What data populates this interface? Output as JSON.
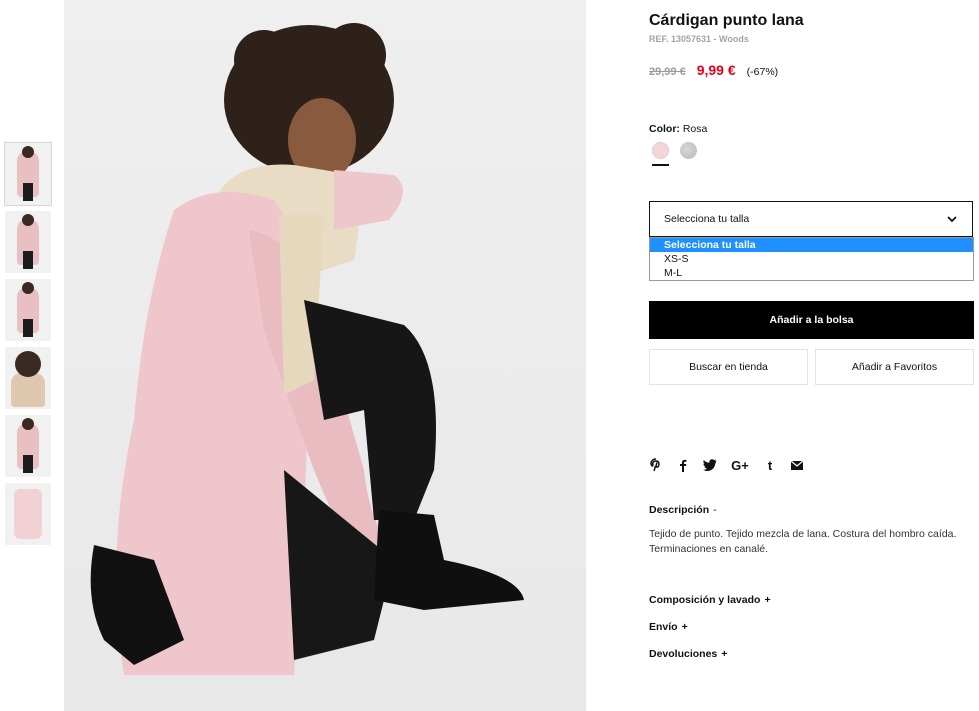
{
  "product": {
    "title": "Cárdigan punto lana",
    "ref": "REF. 13057631 - Woods",
    "old_price": "29,99 €",
    "new_price": "9,99 €",
    "discount": "(-67%)",
    "color_label": "Color:",
    "color_value": "Rosa"
  },
  "colors": {
    "accent_red": "#e3001b",
    "swatch_rosa": "#f3d6d8",
    "swatch_gris": "#c4c4c4",
    "dropdown_highlight": "#1e90ff"
  },
  "size_select": {
    "current": "Selecciona tu talla",
    "options": [
      "Selecciona tu talla",
      "XS-S",
      "M-L"
    ]
  },
  "buttons": {
    "add_to_bag": "Añadir a la bolsa",
    "find_in_store": "Buscar en tienda",
    "add_to_favorites": "Añadir a Favoritos"
  },
  "share_icons": [
    "pinterest-icon",
    "facebook-icon",
    "twitter-icon",
    "google-plus-icon",
    "tumblr-icon",
    "email-icon"
  ],
  "share_glyphs": [
    "P",
    "f",
    "t",
    "G+",
    "t",
    "✉"
  ],
  "description": {
    "heading": "Descripción",
    "toggle": "-",
    "text": "Tejido de punto. Tejido mezcla de lana. Costura del hombro caída. Terminaciones en canalé."
  },
  "accordions": [
    {
      "label": "Composición y lavado",
      "toggle": "+"
    },
    {
      "label": "Envío",
      "toggle": "+"
    },
    {
      "label": "Devoluciones",
      "toggle": "+"
    }
  ]
}
